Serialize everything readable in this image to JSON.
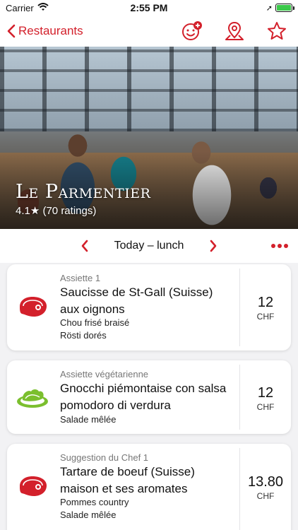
{
  "status_bar": {
    "carrier": "Carrier",
    "time": "2:55 PM"
  },
  "nav": {
    "back_label": "Restaurants"
  },
  "restaurant": {
    "name": "Le Parmentier",
    "rating": "4.1★ (70 ratings)"
  },
  "date_bar": {
    "label": "Today – lunch"
  },
  "accent_color": "#d3202b",
  "menu": [
    {
      "category": "Assiette 1",
      "name_lines": [
        "Saucisse de St-Gall (Suisse)",
        "aux oignons"
      ],
      "sides": [
        "Chou frisé braisé",
        "Rösti dorés"
      ],
      "price": "12",
      "currency": "CHF",
      "icon": "meat-icon"
    },
    {
      "category": "Assiette végétarienne",
      "name_lines": [
        "Gnocchi piémontaise con salsa",
        "pomodoro di verdura"
      ],
      "sides": [
        "Salade mêlée"
      ],
      "price": "12",
      "currency": "CHF",
      "icon": "vegetarian-icon"
    },
    {
      "category": "Suggestion du Chef 1",
      "name_lines": [
        "Tartare de boeuf (Suisse)",
        "maison et ses aromates"
      ],
      "sides": [
        "Pommes country",
        "Salade mêlée"
      ],
      "price": "13.80",
      "currency": "CHF",
      "icon": "meat-icon"
    }
  ]
}
